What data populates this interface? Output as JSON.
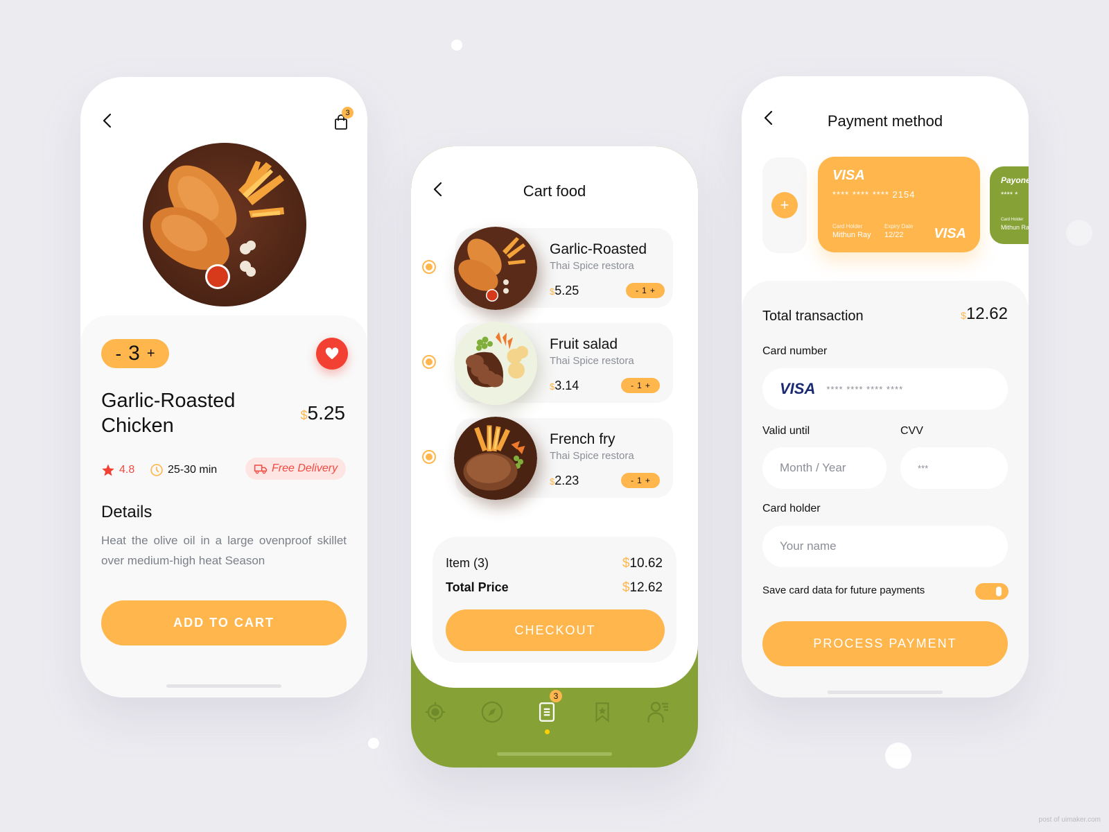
{
  "colors": {
    "accent": "#ffb64d",
    "green": "#86a236",
    "red": "#f24032",
    "background": "#ecebf0"
  },
  "product": {
    "back_icon": "chevron-left-icon",
    "cart_icon": "shopping-bag-icon",
    "cart_badge": "3",
    "quantity_minus": "-",
    "quantity": "3",
    "quantity_plus": "+",
    "favorite_icon": "heart-icon",
    "title_line1": "Garlic-Roasted",
    "title_line2": "Chicken",
    "currency": "$",
    "price": "5.25",
    "rating": "4.8",
    "time": "25-30 min",
    "delivery": "Free Delivery",
    "details_heading": "Details",
    "details_text": "Heat the olive oil in a large ovenproof skillet over medium-high heat Season",
    "add_to_cart": "ADD TO CART"
  },
  "cart": {
    "title": "Cart food",
    "items": [
      {
        "name": "Garlic-Roasted",
        "restaurant": "Thai Spice restora",
        "currency": "$",
        "price": "5.25",
        "qty_minus": "-",
        "qty": "1",
        "qty_plus": "+"
      },
      {
        "name": "Fruit salad",
        "restaurant": "Thai Spice restora",
        "currency": "$",
        "price": "3.14",
        "qty_minus": "-",
        "qty": "1",
        "qty_plus": "+"
      },
      {
        "name": "French fry",
        "restaurant": "Thai Spice restora",
        "currency": "$",
        "price": "2.23",
        "qty_minus": "-",
        "qty": "1",
        "qty_plus": "+"
      }
    ],
    "items_label": "Item (3)",
    "items_currency": "$",
    "items_total": "10.62",
    "total_label": "Total Price",
    "total_currency": "$",
    "total": "12.62",
    "checkout": "CHECKOUT",
    "nav": [
      {
        "icon": "location-target-icon",
        "active": false
      },
      {
        "icon": "compass-icon",
        "active": false
      },
      {
        "icon": "order-list-icon",
        "active": true,
        "badge": "3"
      },
      {
        "icon": "bookmark-star-icon",
        "active": false
      },
      {
        "icon": "profile-icon",
        "active": false
      }
    ]
  },
  "payment": {
    "title": "Payment method",
    "add_card": "+",
    "visa_card": {
      "brand": "VISA",
      "number": "**** **** **** 2154",
      "holder_label": "Card Holder",
      "holder": "Mithun Ray",
      "expiry_label": "Expiry Date",
      "expiry": "12/22"
    },
    "payoneer_card": {
      "brand": "Payoneer",
      "number": "**** *",
      "holder_label": "Card Holder",
      "holder": "Mithun Ra"
    },
    "total_label": "Total transaction",
    "total_currency": "$",
    "total": "12.62",
    "card_number_label": "Card number",
    "card_number_brand": "VISA",
    "card_number_placeholder": "**** **** **** ****",
    "valid_until_label": "Valid until",
    "valid_until_placeholder": "Month / Year",
    "cvv_label": "CVV",
    "cvv_placeholder": "***",
    "card_holder_label": "Card holder",
    "card_holder_placeholder": "Your name",
    "save_card_label": "Save card data for future payments",
    "save_card_enabled": true,
    "process_payment": "PROCESS PAYMENT"
  },
  "watermark": "post of uimaker.com"
}
